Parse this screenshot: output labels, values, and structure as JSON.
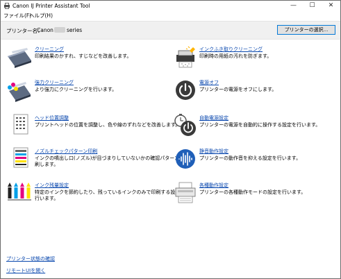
{
  "window": {
    "title": "Canon IJ Printer Assistant Tool",
    "minimize": "—",
    "maximize": "☐",
    "close": "✕"
  },
  "menu": [
    {
      "label": "ファイル(F)"
    },
    {
      "label": "ヘルプ(H)"
    }
  ],
  "printer": {
    "label": "プリンター名：",
    "name": "Canon",
    "series": "series",
    "select_button": "プリンターの選択..."
  },
  "left_items": [
    {
      "title": "クリーニング",
      "desc": [
        "印刷結果のかすれ、すじなどを改善します。"
      ]
    },
    {
      "title": "強力クリーニング",
      "desc": [
        "より強力にクリーニングを行います。"
      ]
    },
    {
      "title": "ヘッド位置調整",
      "desc": [
        "プリントヘッドの位置を調整し、色や線のずれなどを改善します。"
      ]
    },
    {
      "title": "ノズルチェックパターン印刷",
      "desc": [
        "インクの噴出し口(ノズル)が目づまりしていないかの確認パターンを印",
        "刷します。"
      ]
    },
    {
      "title": "インク残量設定",
      "desc": [
        "特定のインクを節約したり、残っているインクのみで印刷する設定を",
        "行います。"
      ]
    }
  ],
  "right_items": [
    {
      "title": "インクふき取りクリーニング",
      "desc": [
        "印刷時の用紙の汚れを防ぎます。"
      ]
    },
    {
      "title": "電源オフ",
      "desc": [
        "プリンターの電源をオフにします。"
      ]
    },
    {
      "title": "自動電源設定",
      "desc": [
        "プリンターの電源を自動的に操作する設定を行います。"
      ]
    },
    {
      "title": "静音動作設定",
      "desc": [
        "プリンターの動作音を抑える設定を行います。"
      ]
    },
    {
      "title": "各種動作設定",
      "desc": [
        "プリンターの各種動作モードの設定を行います。"
      ]
    }
  ],
  "footer": {
    "status_link": "プリンター状態の確認",
    "remote_link": "リモートUIを開く"
  },
  "colors": {
    "link": "#0645ad",
    "accent": "#0078d7",
    "toolbar_bg": "#f0f0f0"
  }
}
